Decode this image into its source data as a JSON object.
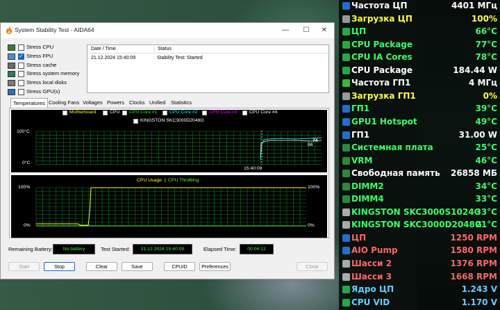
{
  "window": {
    "title": "System Stability Test - AIDA64",
    "minimize_glyph": "—",
    "maximize_glyph": "☐",
    "close_glyph": "✕"
  },
  "stress_options": [
    {
      "label": "Stress CPU",
      "checked": false,
      "icon": "cpu-icon"
    },
    {
      "label": "Stress FPU",
      "checked": true,
      "icon": "fpu-icon"
    },
    {
      "label": "Stress cache",
      "checked": false,
      "icon": "cache-icon"
    },
    {
      "label": "Stress system memory",
      "checked": false,
      "icon": "memory-icon"
    },
    {
      "label": "Stress local disks",
      "checked": false,
      "icon": "disk-icon"
    },
    {
      "label": "Stress GPU(s)",
      "checked": false,
      "icon": "gpu-icon"
    }
  ],
  "status_table": {
    "col_datetime": "Date / Time",
    "col_status": "Status",
    "rows": [
      {
        "datetime": "21.12.2024 15:40:09",
        "status": "Stability Test: Started"
      }
    ]
  },
  "tabs": [
    "Temperatures",
    "Cooling Fans",
    "Voltages",
    "Powers",
    "Clocks",
    "Unified",
    "Statistics"
  ],
  "temp_graph": {
    "legend": [
      {
        "label": "Motherboard",
        "checked": false,
        "color": "#ffff00"
      },
      {
        "label": "CPU",
        "checked": true,
        "color": "#ffffff"
      },
      {
        "label": "CPU Core #1",
        "checked": true,
        "color": "#00ff00"
      },
      {
        "label": "CPU Core #2",
        "checked": true,
        "color": "#00ffff"
      },
      {
        "label": "CPU Core #3",
        "checked": true,
        "color": "#ff00ff"
      },
      {
        "label": "CPU Core #4",
        "checked": true,
        "color": "#ffffff"
      }
    ],
    "legend2": {
      "label": "KINGSTON SKC3000D2048G",
      "checked": false
    },
    "y_top": "100°C",
    "y_bottom": "0°C",
    "time_label": "15:40:09",
    "value_a": "66",
    "value_b": "74"
  },
  "usage_graph": {
    "title_usage": "CPU Usage",
    "title_sep": "|",
    "title_throttle": "CPU Throttling",
    "y_top_left": "100%",
    "y_bottom_left": "0%",
    "y_top_right": "100%",
    "y_bottom_right": "0%"
  },
  "info": {
    "battery_label": "Remaining Battery:",
    "battery_value": "No battery",
    "started_label": "Test Started:",
    "started_value": "21.12.2024 15:40:09",
    "elapsed_label": "Elapsed Time:",
    "elapsed_value": "00:04:12"
  },
  "buttons": {
    "start": "Start",
    "stop": "Stop",
    "clear": "Clear",
    "save": "Save",
    "cpuid": "CPUID",
    "preferences": "Preferences",
    "close": "Close"
  },
  "osd": [
    {
      "label": "Частота ЦП",
      "value": "4401 МГц",
      "color": "#ffffff",
      "icon_color": "#1f6fd0"
    },
    {
      "label": "Загрузка ЦП",
      "value": "100%",
      "color": "#ffff33",
      "icon_color": "#999999"
    },
    {
      "label": "ЦП",
      "value": "66°C",
      "color": "#33ff66",
      "icon_color": "#22aa44"
    },
    {
      "label": "CPU Package",
      "value": "77°C",
      "color": "#33ff66",
      "icon_color": "#22aa44"
    },
    {
      "label": "CPU IA Cores",
      "value": "78°C",
      "color": "#33ff66",
      "icon_color": "#22aa44"
    },
    {
      "label": "CPU Package",
      "value": "184.44 W",
      "color": "#ffffff",
      "icon_color": "#22aa44"
    },
    {
      "label": "Частота ГП1",
      "value": "4 МГц",
      "color": "#ffffff",
      "icon_color": "#33bb33"
    },
    {
      "label": "Загрузка ГП1",
      "value": "0%",
      "color": "#ffff33",
      "icon_color": "#999999"
    },
    {
      "label": "ГП1",
      "value": "39°C",
      "color": "#33ff66",
      "icon_color": "#1f6fd0"
    },
    {
      "label": "GPU1 Hotspot",
      "value": "49°C",
      "color": "#33ff66",
      "icon_color": "#1f6fd0"
    },
    {
      "label": "ГП1",
      "value": "31.00 W",
      "color": "#ffffff",
      "icon_color": "#1f6fd0"
    },
    {
      "label": "Системная плата",
      "value": "25°C",
      "color": "#33ff66",
      "icon_color": "#2a8a3a"
    },
    {
      "label": "VRM",
      "value": "46°C",
      "color": "#33ff66",
      "icon_color": "#2a8a3a"
    },
    {
      "label": "Свободная память",
      "value": "26858 МБ",
      "color": "#ffffff",
      "icon_color": "#2a8a3a"
    },
    {
      "label": "DIMM2",
      "value": "34°C",
      "color": "#33ff66",
      "icon_color": "#2a8a3a"
    },
    {
      "label": "DIMM4",
      "value": "33°C",
      "color": "#33ff66",
      "icon_color": "#2a8a3a"
    },
    {
      "label": "KINGSTON SKC3000S1024G",
      "value": "33°C",
      "color": "#33ff66",
      "icon_color": "#aaaaaa"
    },
    {
      "label": "KINGSTON SKC3000D2048G",
      "value": "21°C",
      "color": "#33ff66",
      "icon_color": "#aaaaaa"
    },
    {
      "label": "ЦП",
      "value": "1250 RPM",
      "color": "#ff6666",
      "icon_color": "#1f6fd0"
    },
    {
      "label": "AIO Pump",
      "value": "1580 RPM",
      "color": "#ff6666",
      "icon_color": "#1f6fd0"
    },
    {
      "label": "Шасси 2",
      "value": "1376 RPM",
      "color": "#ff6666",
      "icon_color": "#aaaaaa"
    },
    {
      "label": "Шасси 3",
      "value": "1668 RPM",
      "color": "#ff6666",
      "icon_color": "#aaaaaa"
    },
    {
      "label": "Ядро ЦП",
      "value": "1.243 V",
      "color": "#66ccff",
      "icon_color": "#22aa44"
    },
    {
      "label": "CPU VID",
      "value": "1.170 V",
      "color": "#66ccff",
      "icon_color": "#22aa44"
    }
  ]
}
